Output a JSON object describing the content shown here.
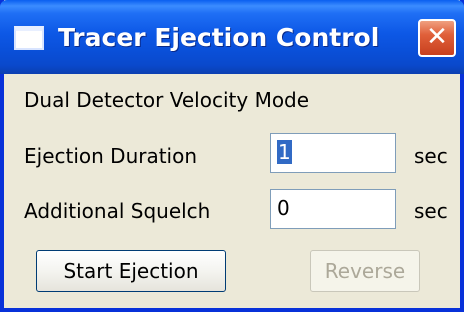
{
  "window": {
    "title": "Tracer Ejection Control",
    "close_glyph": "✕",
    "icon": "window-icon"
  },
  "mode_label": "Dual Detector Velocity Mode",
  "fields": [
    {
      "label": "Ejection Duration",
      "value": "1",
      "unit": "sec"
    },
    {
      "label": "Additional Squelch",
      "value": "0",
      "unit": "sec"
    }
  ],
  "buttons": {
    "start": "Start Ejection",
    "reverse": "Reverse"
  },
  "colors": {
    "titlebar": "#0a4fd8",
    "close": "#e0603a",
    "face": "#ece9d8",
    "selection": "#316ac5"
  }
}
